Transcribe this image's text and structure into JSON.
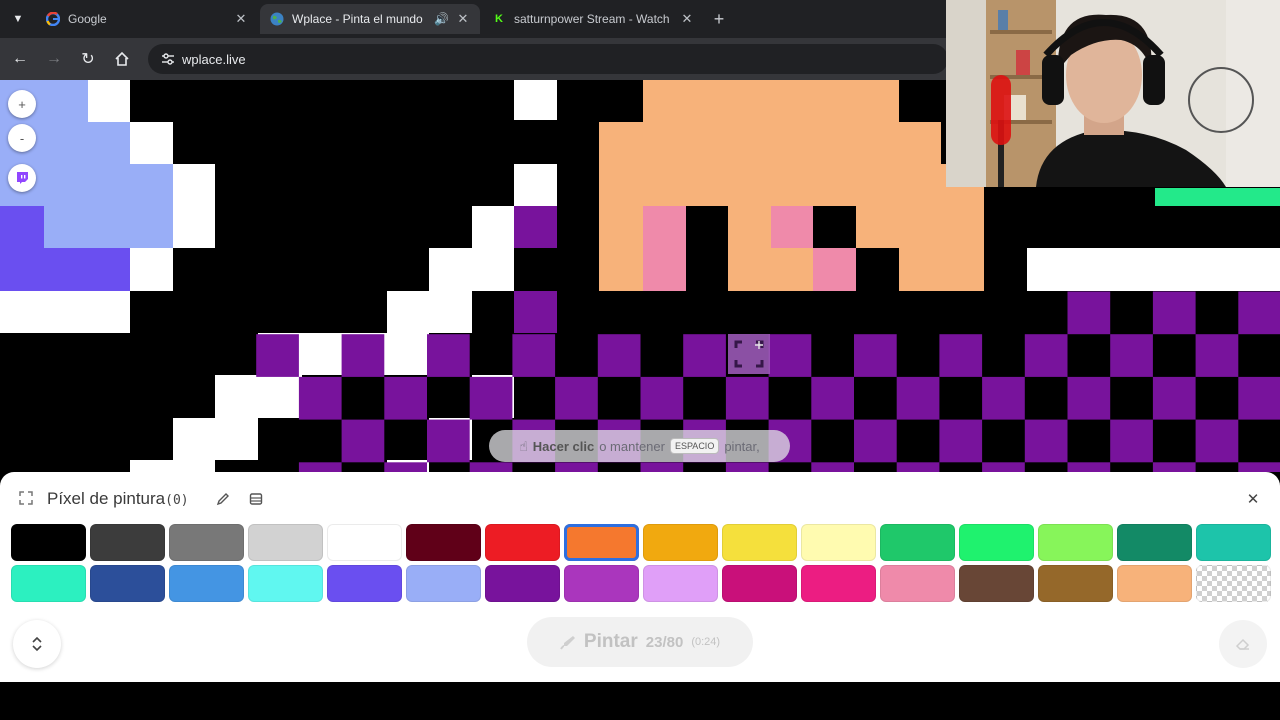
{
  "browser": {
    "tabs": [
      {
        "title": "Google",
        "favicon": "google-favicon",
        "active": false
      },
      {
        "title": "Wplace - Pinta el mundo",
        "favicon": "globe-favicon",
        "active": true,
        "audio": true
      },
      {
        "title": "satturnpower Stream - Watch Li",
        "favicon": "kick-favicon",
        "active": false
      }
    ],
    "url": "wplace.live"
  },
  "map_controls": {
    "zoom_in": "+",
    "zoom_out": "-"
  },
  "hint": {
    "bold": "Hacer clic",
    "text1": "o mantener",
    "key": "ESPACIO",
    "text2": "pintar,"
  },
  "panel": {
    "title": "Píxel de pintura",
    "count": "(0)",
    "selected_color": "#f5782e",
    "palette": [
      {
        "name": "black",
        "hex": "#000000"
      },
      {
        "name": "dark-gray",
        "hex": "#3c3c3c"
      },
      {
        "name": "gray",
        "hex": "#787878"
      },
      {
        "name": "light-gray",
        "hex": "#d2d2d2"
      },
      {
        "name": "white",
        "hex": "#ffffff"
      },
      {
        "name": "deep-red",
        "hex": "#600018"
      },
      {
        "name": "red",
        "hex": "#ed1c24"
      },
      {
        "name": "orange",
        "hex": "#f5782e"
      },
      {
        "name": "gold",
        "hex": "#f1a90f"
      },
      {
        "name": "yellow",
        "hex": "#f5e03c"
      },
      {
        "name": "light-yellow",
        "hex": "#fffbb0"
      },
      {
        "name": "dark-green",
        "hex": "#1fc86a"
      },
      {
        "name": "green",
        "hex": "#1ff26e"
      },
      {
        "name": "light-green",
        "hex": "#87f55a"
      },
      {
        "name": "dark-teal",
        "hex": "#138a66"
      },
      {
        "name": "teal",
        "hex": "#1dc4aa"
      },
      {
        "name": "light-teal",
        "hex": "#2cf0c0"
      },
      {
        "name": "dark-blue",
        "hex": "#2c4f9a"
      },
      {
        "name": "blue",
        "hex": "#4495e3"
      },
      {
        "name": "cyan",
        "hex": "#60f7f0"
      },
      {
        "name": "indigo",
        "hex": "#6a4ff0"
      },
      {
        "name": "light-indigo",
        "hex": "#99aef7"
      },
      {
        "name": "dark-purple",
        "hex": "#78139c"
      },
      {
        "name": "purple",
        "hex": "#aa36bd"
      },
      {
        "name": "light-purple",
        "hex": "#e09ff8"
      },
      {
        "name": "dark-pink",
        "hex": "#c9107a"
      },
      {
        "name": "pink",
        "hex": "#ec1d82"
      },
      {
        "name": "light-pink",
        "hex": "#ef8aaa"
      },
      {
        "name": "dark-brown",
        "hex": "#684636"
      },
      {
        "name": "brown",
        "hex": "#95682a"
      },
      {
        "name": "beige",
        "hex": "#f7b27a"
      },
      {
        "name": "transparent",
        "hex": "transparent"
      }
    ],
    "paint_button": {
      "label": "Pintar",
      "charges": "23/80",
      "timer": "(0:24)"
    }
  }
}
